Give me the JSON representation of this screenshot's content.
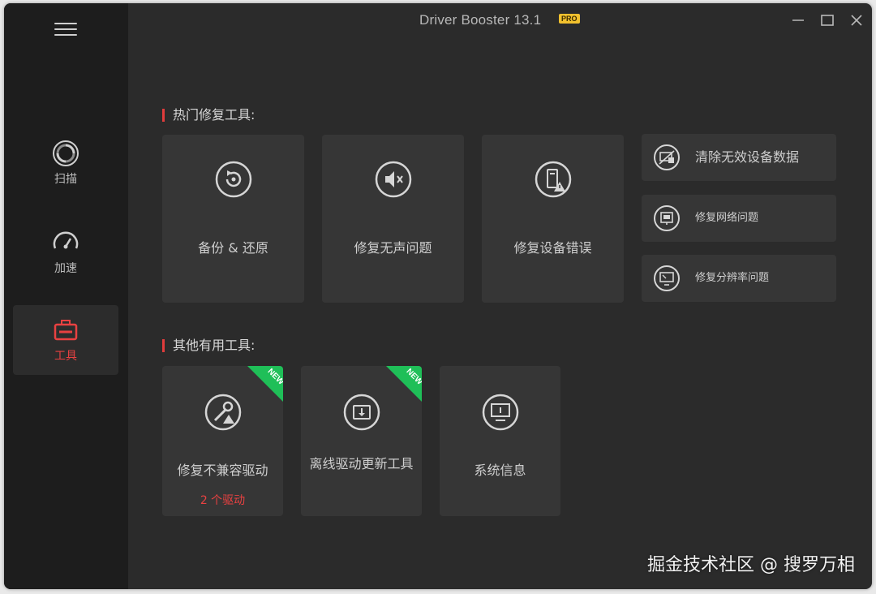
{
  "app": {
    "title": "Driver Booster 13.1",
    "badge": "PRO"
  },
  "sidebar": {
    "items": [
      {
        "label": "扫描",
        "icon": "scan-icon"
      },
      {
        "label": "加速",
        "icon": "speedometer-icon"
      },
      {
        "label": "工具",
        "icon": "toolbox-icon",
        "active": true
      }
    ]
  },
  "hot_tools": {
    "title": "热门修复工具:",
    "tiles": [
      {
        "label": "备份 & 还原",
        "icon": "backup-restore-icon"
      },
      {
        "label": "修复无声问题",
        "icon": "mute-speaker-icon"
      },
      {
        "label": "修复设备错误",
        "icon": "device-warning-icon"
      }
    ],
    "rows": [
      {
        "label": "清除无效设备数据",
        "icon": "clean-device-icon"
      },
      {
        "label": "修复网络问题",
        "icon": "network-icon"
      },
      {
        "label": "修复分辨率问题",
        "icon": "resolution-icon"
      }
    ]
  },
  "other_tools": {
    "title": "其他有用工具:",
    "tiles": [
      {
        "label": "修复不兼容驱动",
        "sub": "2 个驱动",
        "badge": "NEW",
        "icon": "wrench-warning-icon"
      },
      {
        "label": "离线驱动更新工具",
        "badge": "NEW",
        "icon": "offline-update-icon"
      },
      {
        "label": "系统信息",
        "icon": "system-info-icon"
      }
    ]
  },
  "watermark": "掘金技术社区 @ 搜罗万相",
  "colors": {
    "accent": "#e84141",
    "new_badge": "#1fbf58",
    "pro_badge": "#f2c12e"
  }
}
